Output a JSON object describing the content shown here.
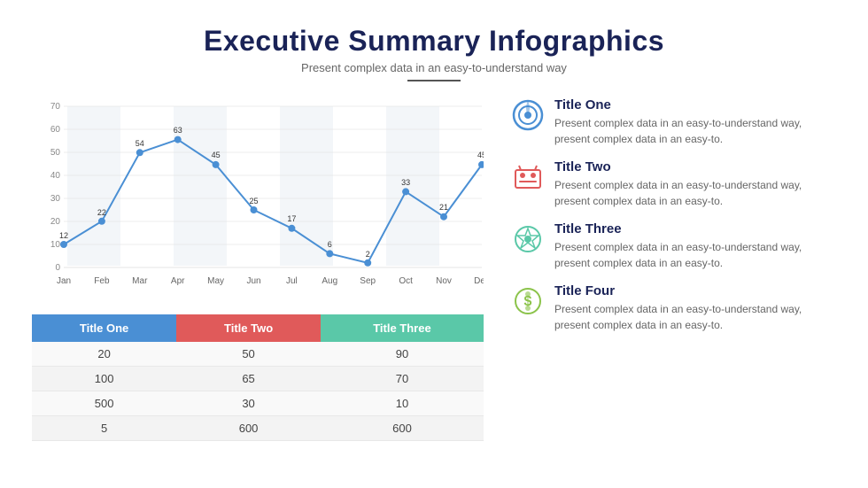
{
  "header": {
    "title": "Executive Summary Infographics",
    "subtitle": "Present complex data in an easy-to-understand way"
  },
  "chart": {
    "months": [
      "Jan",
      "Feb",
      "Mar",
      "Apr",
      "May",
      "Jun",
      "Jul",
      "Aug",
      "Sep",
      "Oct",
      "Nov",
      "Dec"
    ],
    "values": [
      12,
      22,
      54,
      63,
      45,
      25,
      17,
      6,
      2,
      33,
      21,
      45
    ],
    "yMax": 70,
    "yStep": 10
  },
  "table": {
    "headers": [
      "Title One",
      "Title Two",
      "Title Three"
    ],
    "rows": [
      [
        20,
        50,
        90
      ],
      [
        100,
        65,
        70
      ],
      [
        500,
        30,
        10
      ],
      [
        5,
        600,
        600
      ]
    ]
  },
  "info_items": [
    {
      "id": "one",
      "title": "Title One",
      "description": "Present complex data in an easy-to-understand way, present complex data in an easy-to.",
      "icon_color": "#4a8fd4"
    },
    {
      "id": "two",
      "title": "Title Two",
      "description": "Present complex data in an easy-to-understand way, present complex data in an easy-to.",
      "icon_color": "#e05a5a"
    },
    {
      "id": "three",
      "title": "Title Three",
      "description": "Present complex data in an easy-to-understand way, present complex data in an easy-to.",
      "icon_color": "#5ac8a8"
    },
    {
      "id": "four",
      "title": "Title Four",
      "description": "Present complex data in an easy-to-understand way, present complex data in an easy-to.",
      "icon_color": "#8bc34a"
    }
  ]
}
